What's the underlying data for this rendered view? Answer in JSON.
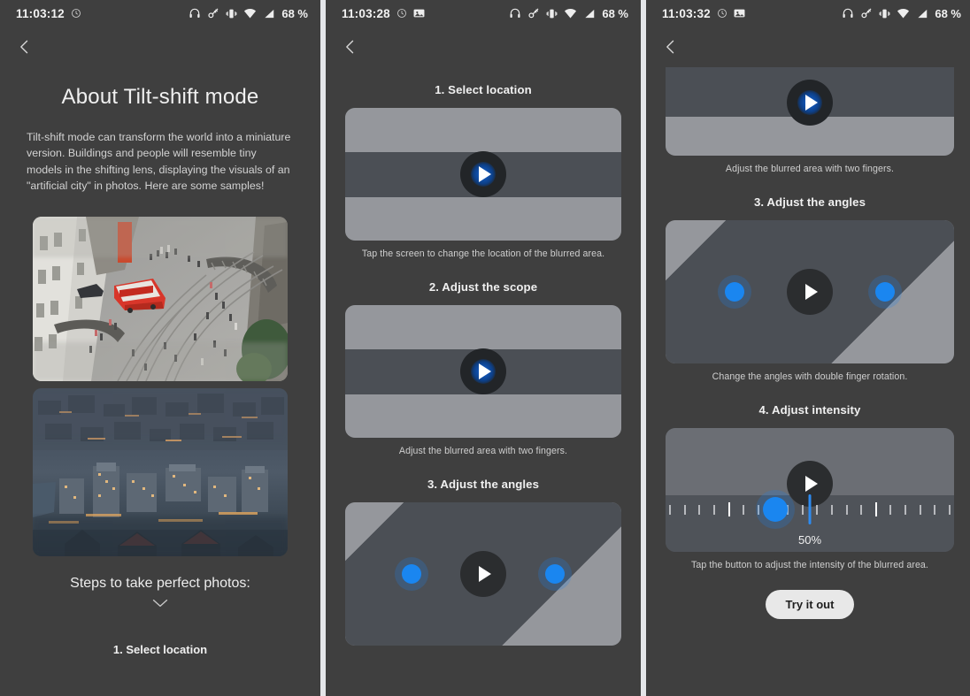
{
  "panels": [
    {
      "status": {
        "time": "11:03:12",
        "icons_left": [
          "alarm-clock-icon"
        ],
        "icons_right": [
          "headphones-icon",
          "key-icon",
          "vibrate-icon",
          "wifi-icon",
          "signal-icon"
        ],
        "battery": "68 %"
      },
      "back_label": "Back",
      "title": "About Tilt-shift mode",
      "description": "Tilt-shift mode can transform the world into a miniature version. Buildings and people will resemble tiny models in the shifting lens, displaying the visuals of an \"artificial city\" in photos. Here are some samples!",
      "samples": [
        {
          "caption": "Aerial view of a city street with a red tram"
        },
        {
          "caption": "Aerial view of a city at dusk"
        }
      ],
      "steps_heading": "Steps to take perfect photos:",
      "expand_icon": "chevron-down-icon",
      "first_step": "1. Select location"
    },
    {
      "status": {
        "time": "11:03:28",
        "icons_left": [
          "alarm-clock-icon",
          "screenshot-icon"
        ],
        "icons_right": [
          "headphones-icon",
          "key-icon",
          "vibrate-icon",
          "wifi-icon",
          "signal-icon"
        ],
        "battery": "68 %"
      },
      "back_label": "Back",
      "steps": [
        {
          "title": "1. Select location",
          "caption": "Tap the screen to change the location of the blurred area.",
          "art": "bands"
        },
        {
          "title": "2. Adjust the scope",
          "caption": "Adjust the blurred area with two fingers.",
          "art": "bands"
        },
        {
          "title": "3. Adjust the angles",
          "caption": "",
          "art": "diagonal"
        }
      ]
    },
    {
      "status": {
        "time": "11:03:32",
        "icons_left": [
          "alarm-clock-icon",
          "screenshot-icon"
        ],
        "icons_right": [
          "headphones-icon",
          "key-icon",
          "vibrate-icon",
          "wifi-icon",
          "signal-icon"
        ],
        "battery": "68 %"
      },
      "back_label": "Back",
      "partial_caption": "Adjust the blurred area with two fingers.",
      "steps": [
        {
          "title": "3. Adjust the angles",
          "caption": "Change the angles with double finger rotation.",
          "art": "diagonal"
        },
        {
          "title": "4. Adjust intensity",
          "caption": "Tap the button to adjust the intensity of the blurred area.",
          "art": "slider",
          "intensity": "50%"
        }
      ],
      "cta": "Try it out"
    }
  ],
  "colors": {
    "background": "#3f3f3f",
    "accent_blue": "#1a86f0",
    "card_light": "#95979c",
    "card_dark": "#4b4f55",
    "text_primary": "#f0f0f0",
    "text_secondary": "#cfcfcf",
    "cta_bg": "#e8e8e8"
  }
}
